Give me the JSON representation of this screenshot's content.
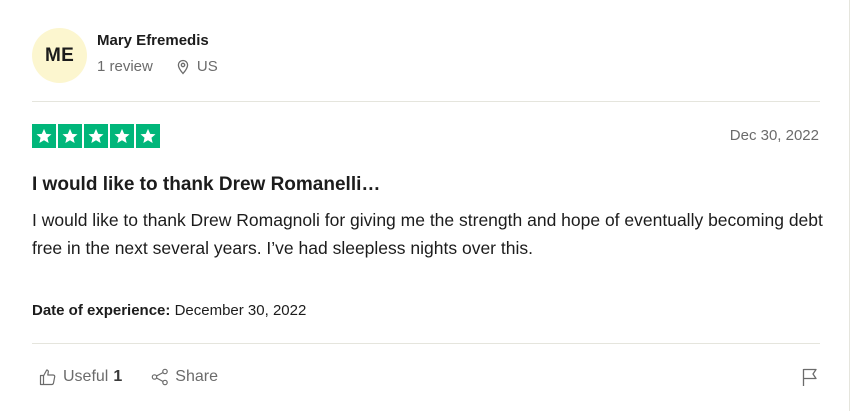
{
  "review": {
    "consumer": {
      "initials": "ME",
      "name": "Mary Efremedis",
      "review_count": "1 review",
      "country": "US"
    },
    "rating": 5,
    "date": "Dec 30, 2022",
    "title": "I would like to thank Drew Romanelli…",
    "text": "I would like to thank Drew Romagnoli for giving me the strength and hope of eventually becoming debt free in the next several years. I’ve had sleepless nights over this.",
    "experience": {
      "label": "Date of experience:",
      "value": "December 30, 2022"
    },
    "actions": {
      "useful_label": "Useful",
      "useful_count": "1",
      "share_label": "Share"
    }
  },
  "colors": {
    "star_green": "#00b67a",
    "avatar_bg": "#fcf6cf",
    "muted_text": "#6b6b6b",
    "divider": "#e5e5dd"
  },
  "icons": {
    "location": "location-pin-icon",
    "useful": "thumbs-up-icon",
    "share": "share-icon",
    "flag": "flag-icon",
    "star": "star-icon"
  }
}
